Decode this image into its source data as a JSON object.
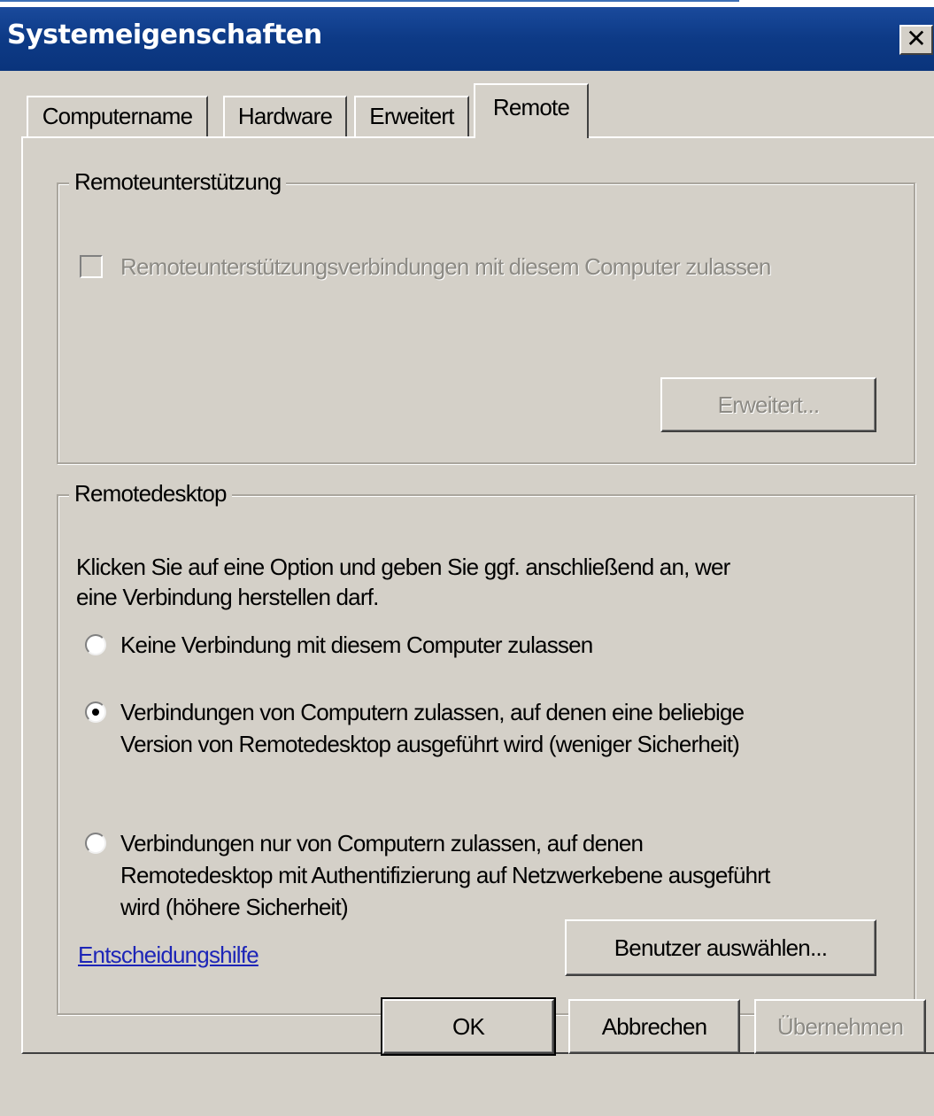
{
  "window": {
    "title": "Systemeigenschaften",
    "close_label": "✕"
  },
  "tabs": [
    {
      "label": "Computername",
      "active": false
    },
    {
      "label": "Hardware",
      "active": false
    },
    {
      "label": "Erweitert",
      "active": false
    },
    {
      "label": "Remote",
      "active": true
    }
  ],
  "remote_assistance": {
    "group_label": "Remoteunterstützung",
    "checkbox_label": "Remoteunterstützungsverbindungen mit diesem Computer zulassen",
    "checkbox_checked": false,
    "checkbox_enabled": false,
    "advanced_button": "Erweitert..."
  },
  "remote_desktop": {
    "group_label": "Remotedesktop",
    "instructions_line1": "Klicken Sie auf eine Option und geben Sie ggf. anschließend an, wer",
    "instructions_line2": "eine Verbindung herstellen darf.",
    "options": [
      {
        "lines": [
          "Keine Verbindung mit diesem Computer zulassen"
        ],
        "selected": false
      },
      {
        "lines": [
          "Verbindungen von Computern zulassen, auf denen eine beliebige",
          "Version von Remotedesktop ausgeführt wird (weniger Sicherheit)"
        ],
        "selected": true
      },
      {
        "lines": [
          "Verbindungen nur von Computern zulassen, auf denen",
          "Remotedesktop mit Authentifizierung auf Netzwerkebene ausgeführt",
          "wird (höhere Sicherheit)"
        ],
        "selected": false
      }
    ],
    "help_link": "Entscheidungshilfe",
    "select_users_button": "Benutzer auswählen..."
  },
  "footer": {
    "ok": "OK",
    "cancel": "Abbrechen",
    "apply": "Übernehmen"
  }
}
